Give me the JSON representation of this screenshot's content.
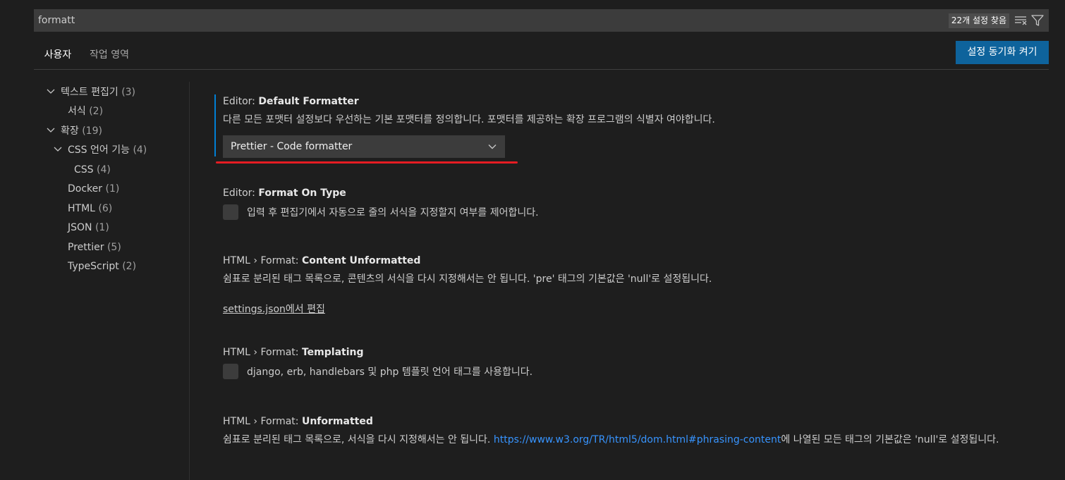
{
  "search": {
    "query": "formatt",
    "result_count": "22개 설정 찾음",
    "clear_icon": "clear-filter-icon",
    "filter_icon": "filter-icon"
  },
  "tabs": [
    {
      "label": "사용자",
      "active": true
    },
    {
      "label": "작업 영역",
      "active": false
    }
  ],
  "sync_button": "설정 동기화 켜기",
  "toc": [
    {
      "label": "텍스트 편집기",
      "count": "(3)",
      "expanded": true
    },
    {
      "label": "서식",
      "count": "(2)"
    },
    {
      "label": "확장",
      "count": "(19)",
      "expanded": true
    },
    {
      "label": "CSS 언어 기능",
      "count": "(4)",
      "expanded": true
    },
    {
      "label": "CSS",
      "count": "(4)"
    },
    {
      "label": "Docker",
      "count": "(1)"
    },
    {
      "label": "HTML",
      "count": "(6)"
    },
    {
      "label": "JSON",
      "count": "(1)"
    },
    {
      "label": "Prettier",
      "count": "(5)"
    },
    {
      "label": "TypeScript",
      "count": "(2)"
    }
  ],
  "settings": {
    "default_formatter": {
      "category": "Editor: ",
      "name": "Default Formatter",
      "description": "다른 모든 포맷터 설정보다 우선하는 기본 포맷터를 정의합니다. 포맷터를 제공하는 확장 프로그램의 식별자 여야합니다.",
      "value": "Prettier - Code formatter"
    },
    "format_on_type": {
      "category": "Editor: ",
      "name": "Format On Type",
      "description": "입력 후 편집기에서 자동으로 줄의 서식을 지정할지 여부를 제어합니다."
    },
    "content_unformatted": {
      "category": "HTML › Format: ",
      "name": "Content Unformatted",
      "description": "쉼표로 분리된 태그 목록으로, 콘텐츠의 서식을 다시 지정해서는 안 됩니다. 'pre' 태그의 기본값은 'null'로 설정됩니다.",
      "edit_link": "settings.json에서 편집"
    },
    "templating": {
      "category": "HTML › Format: ",
      "name": "Templating",
      "description": "django, erb, handlebars 및 php 템플릿 언어 태그를 사용합니다."
    },
    "unformatted": {
      "category": "HTML › Format: ",
      "name": "Unformatted",
      "description_before": "쉼표로 분리된 태그 목록으로, 서식을 다시 지정해서는 안 됩니다. ",
      "link": "https://www.w3.org/TR/html5/dom.html#phrasing-content",
      "description_after": "에 나열된 모든 태그의 기본값은 'null'로 설정됩니다."
    }
  }
}
